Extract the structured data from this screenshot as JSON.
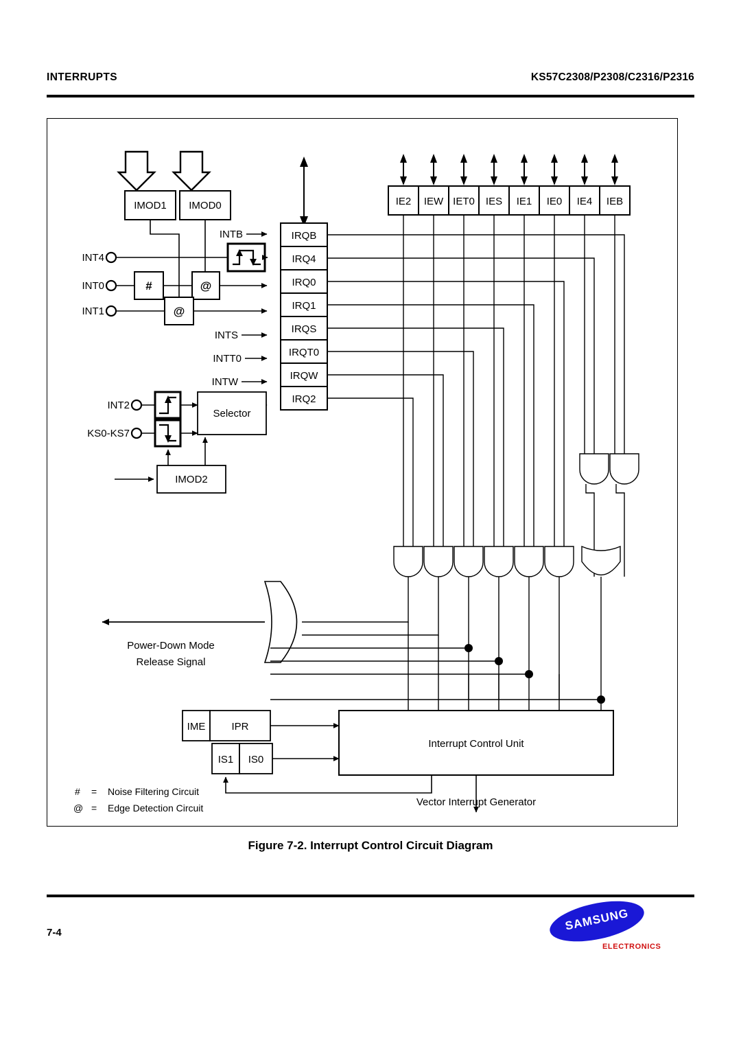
{
  "header": {
    "left": "INTERRUPTS",
    "right": "KS57C2308/P2308/C2316/P2316"
  },
  "caption": "Figure 7-2. Interrupt Control Circuit Diagram",
  "footer": {
    "page_number": "7-4",
    "logo_text": "SAMSUNG",
    "logo_sub": "ELECTRONICS",
    "logo_color": "#1a18d6",
    "logo_sub_color": "#d01010"
  },
  "diagram": {
    "mode_registers": [
      {
        "label": "IMOD1"
      },
      {
        "label": "IMOD0"
      }
    ],
    "imod2": {
      "label": "IMOD2"
    },
    "selector": {
      "label": "Selector"
    },
    "external_pins": [
      {
        "label": "INT4"
      },
      {
        "label": "INT0"
      },
      {
        "label": "INT1"
      },
      {
        "label": "INT2"
      },
      {
        "label": "KS0-KS7"
      }
    ],
    "internal_sources": [
      {
        "label": "INTB"
      },
      {
        "label": "INTS"
      },
      {
        "label": "INTT0"
      },
      {
        "label": "INTW"
      }
    ],
    "conditioning_blocks": [
      {
        "label": "#",
        "kind": "noise-filter"
      },
      {
        "label": "@",
        "kind": "edge-detect"
      },
      {
        "label": "@",
        "kind": "edge-detect"
      }
    ],
    "irq_flags": [
      {
        "label": "IRQB"
      },
      {
        "label": "IRQ4"
      },
      {
        "label": "IRQ0"
      },
      {
        "label": "IRQ1"
      },
      {
        "label": "IRQS"
      },
      {
        "label": "IRQT0"
      },
      {
        "label": "IRQW"
      },
      {
        "label": "IRQ2"
      }
    ],
    "ie_flags": [
      {
        "label": "IE2"
      },
      {
        "label": "IEW"
      },
      {
        "label": "IET0"
      },
      {
        "label": "IES"
      },
      {
        "label": "IE1"
      },
      {
        "label": "IE0"
      },
      {
        "label": "IE4"
      },
      {
        "label": "IEB"
      }
    ],
    "power_down_label_line1": "Power-Down Mode",
    "power_down_label_line2": "Release Signal",
    "control_registers": [
      {
        "label": "IME"
      },
      {
        "label": "IPR"
      },
      {
        "label": "IS1"
      },
      {
        "label": "IS0"
      }
    ],
    "control_unit": {
      "label": "Interrupt Control Unit"
    },
    "vector_generator": {
      "label": "Vector Interrupt Generator"
    },
    "legend": [
      {
        "symbol": "#",
        "equals": "=",
        "text": "Noise Filtering Circuit"
      },
      {
        "symbol": "@",
        "equals": "=",
        "text": "Edge Detection Circuit"
      }
    ]
  }
}
